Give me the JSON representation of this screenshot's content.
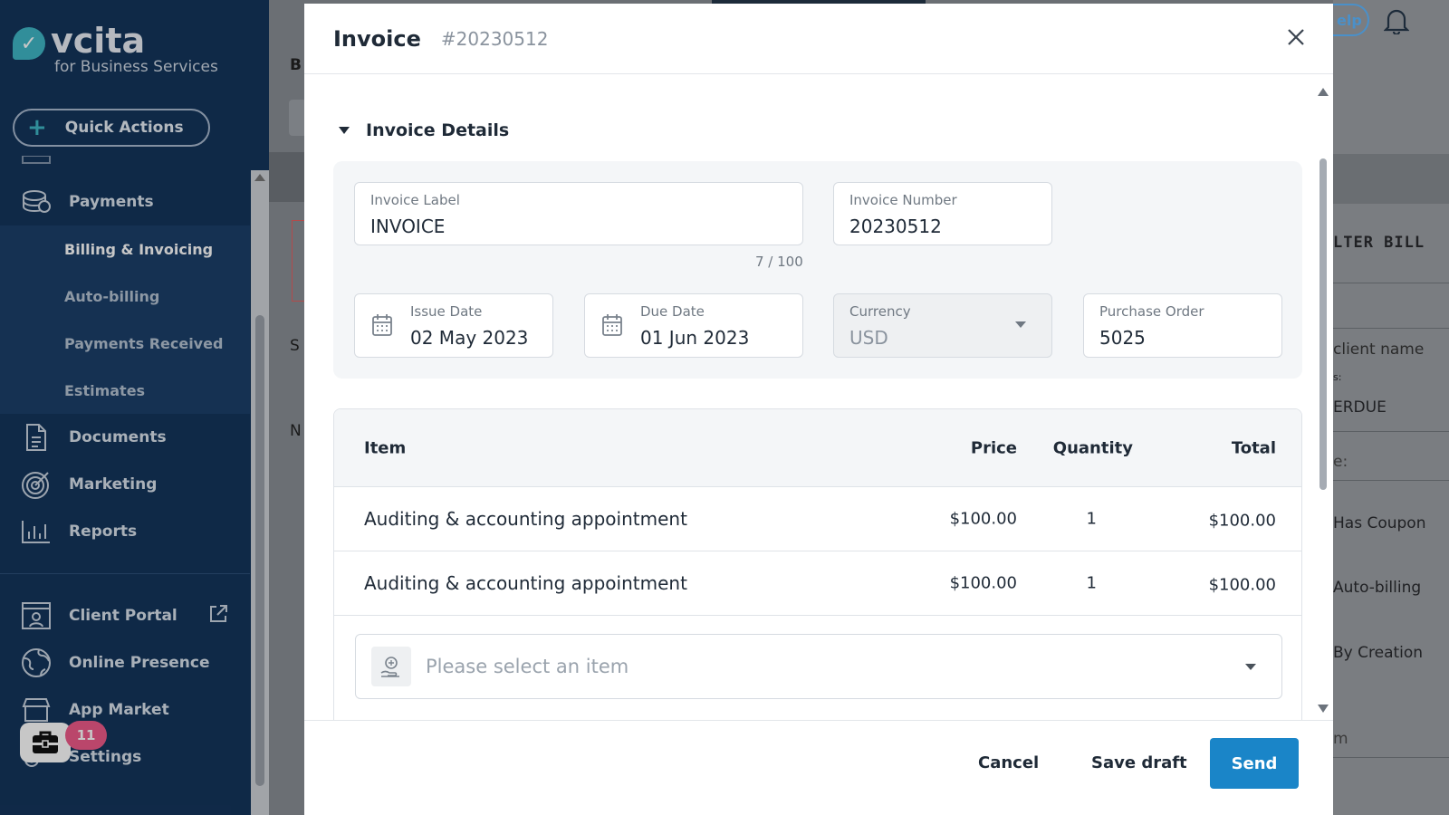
{
  "sidebar": {
    "brand": "vcita",
    "brand_sub": "for Business Services",
    "quick_actions_label": "Quick Actions",
    "items": {
      "payments": "Payments",
      "billing": "Billing & Invoicing",
      "auto_billing": "Auto-billing",
      "payments_received": "Payments Received",
      "estimates": "Estimates",
      "documents": "Documents",
      "marketing": "Marketing",
      "reports": "Reports",
      "client_portal": "Client Portal",
      "online_presence": "Online Presence",
      "app_market": "App Market",
      "settings": "Settings"
    },
    "notification_count": "11"
  },
  "background": {
    "help_label": "elp",
    "left_letter_b": "B",
    "left_letter_s": "S",
    "left_letter_n": "N",
    "right_texts": {
      "filter_header": "LTER BILL",
      "client_name": "client name",
      "colon_label": "s:",
      "overdue": "ERDUE",
      "e_label": "e:",
      "has_coupon": "Has Coupon",
      "auto_billing": "Auto-billing",
      "by_creation": "By Creation",
      "m_label": "m"
    }
  },
  "modal": {
    "title": "Invoice",
    "number": "#20230512",
    "section_title": "Invoice Details",
    "fields": {
      "invoice_label": {
        "label": "Invoice Label",
        "value": "INVOICE",
        "char_count": "7 / 100"
      },
      "invoice_number": {
        "label": "Invoice Number",
        "value": "20230512"
      },
      "issue_date": {
        "label": "Issue Date",
        "value": "02 May 2023"
      },
      "due_date": {
        "label": "Due Date",
        "value": "01 Jun 2023"
      },
      "currency": {
        "label": "Currency",
        "value": "USD"
      },
      "purchase_order": {
        "label": "Purchase Order",
        "value": "5025"
      }
    },
    "table": {
      "headers": {
        "item": "Item",
        "price": "Price",
        "quantity": "Quantity",
        "total": "Total"
      },
      "rows": [
        {
          "item": "Auditing & accounting appointment",
          "price": "$100.00",
          "quantity": "1",
          "total": "$100.00"
        },
        {
          "item": "Auditing & accounting appointment",
          "price": "$100.00",
          "quantity": "1",
          "total": "$100.00"
        }
      ],
      "select_placeholder": "Please select an item"
    },
    "footer": {
      "cancel": "Cancel",
      "save_draft": "Save draft",
      "send": "Send"
    }
  },
  "colors": {
    "sidebar_bg": "#14355c",
    "accent_teal": "#3fb6c6",
    "send_blue": "#1a85c8",
    "badge_pink": "#ef5a8a"
  }
}
